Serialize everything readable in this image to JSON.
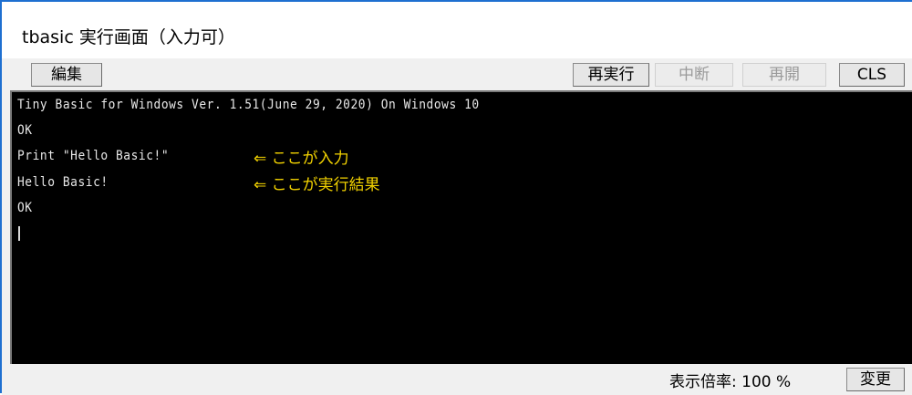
{
  "window": {
    "title": "tbasic 実行画面（入力可）"
  },
  "toolbar": {
    "edit_label": "編集",
    "rerun_label": "再実行",
    "pause_label": "中断",
    "resume_label": "再開",
    "cls_label": "CLS"
  },
  "console": {
    "lines": [
      "Tiny Basic for Windows Ver. 1.51(June 29, 2020) On Windows 10",
      "OK",
      "Print \"Hello Basic!\"",
      "Hello Basic!",
      "OK"
    ],
    "annotations": [
      "⇐ ここが入力",
      "⇐ ここが実行結果"
    ]
  },
  "statusbar": {
    "zoom_label": "表示倍率:",
    "zoom_value": "100 %",
    "change_label": "変更"
  },
  "colors": {
    "console_bg": "#000000",
    "console_text": "#e8e8e8",
    "annotation_text": "#f2d200",
    "window_border": "#1e6fd0"
  }
}
